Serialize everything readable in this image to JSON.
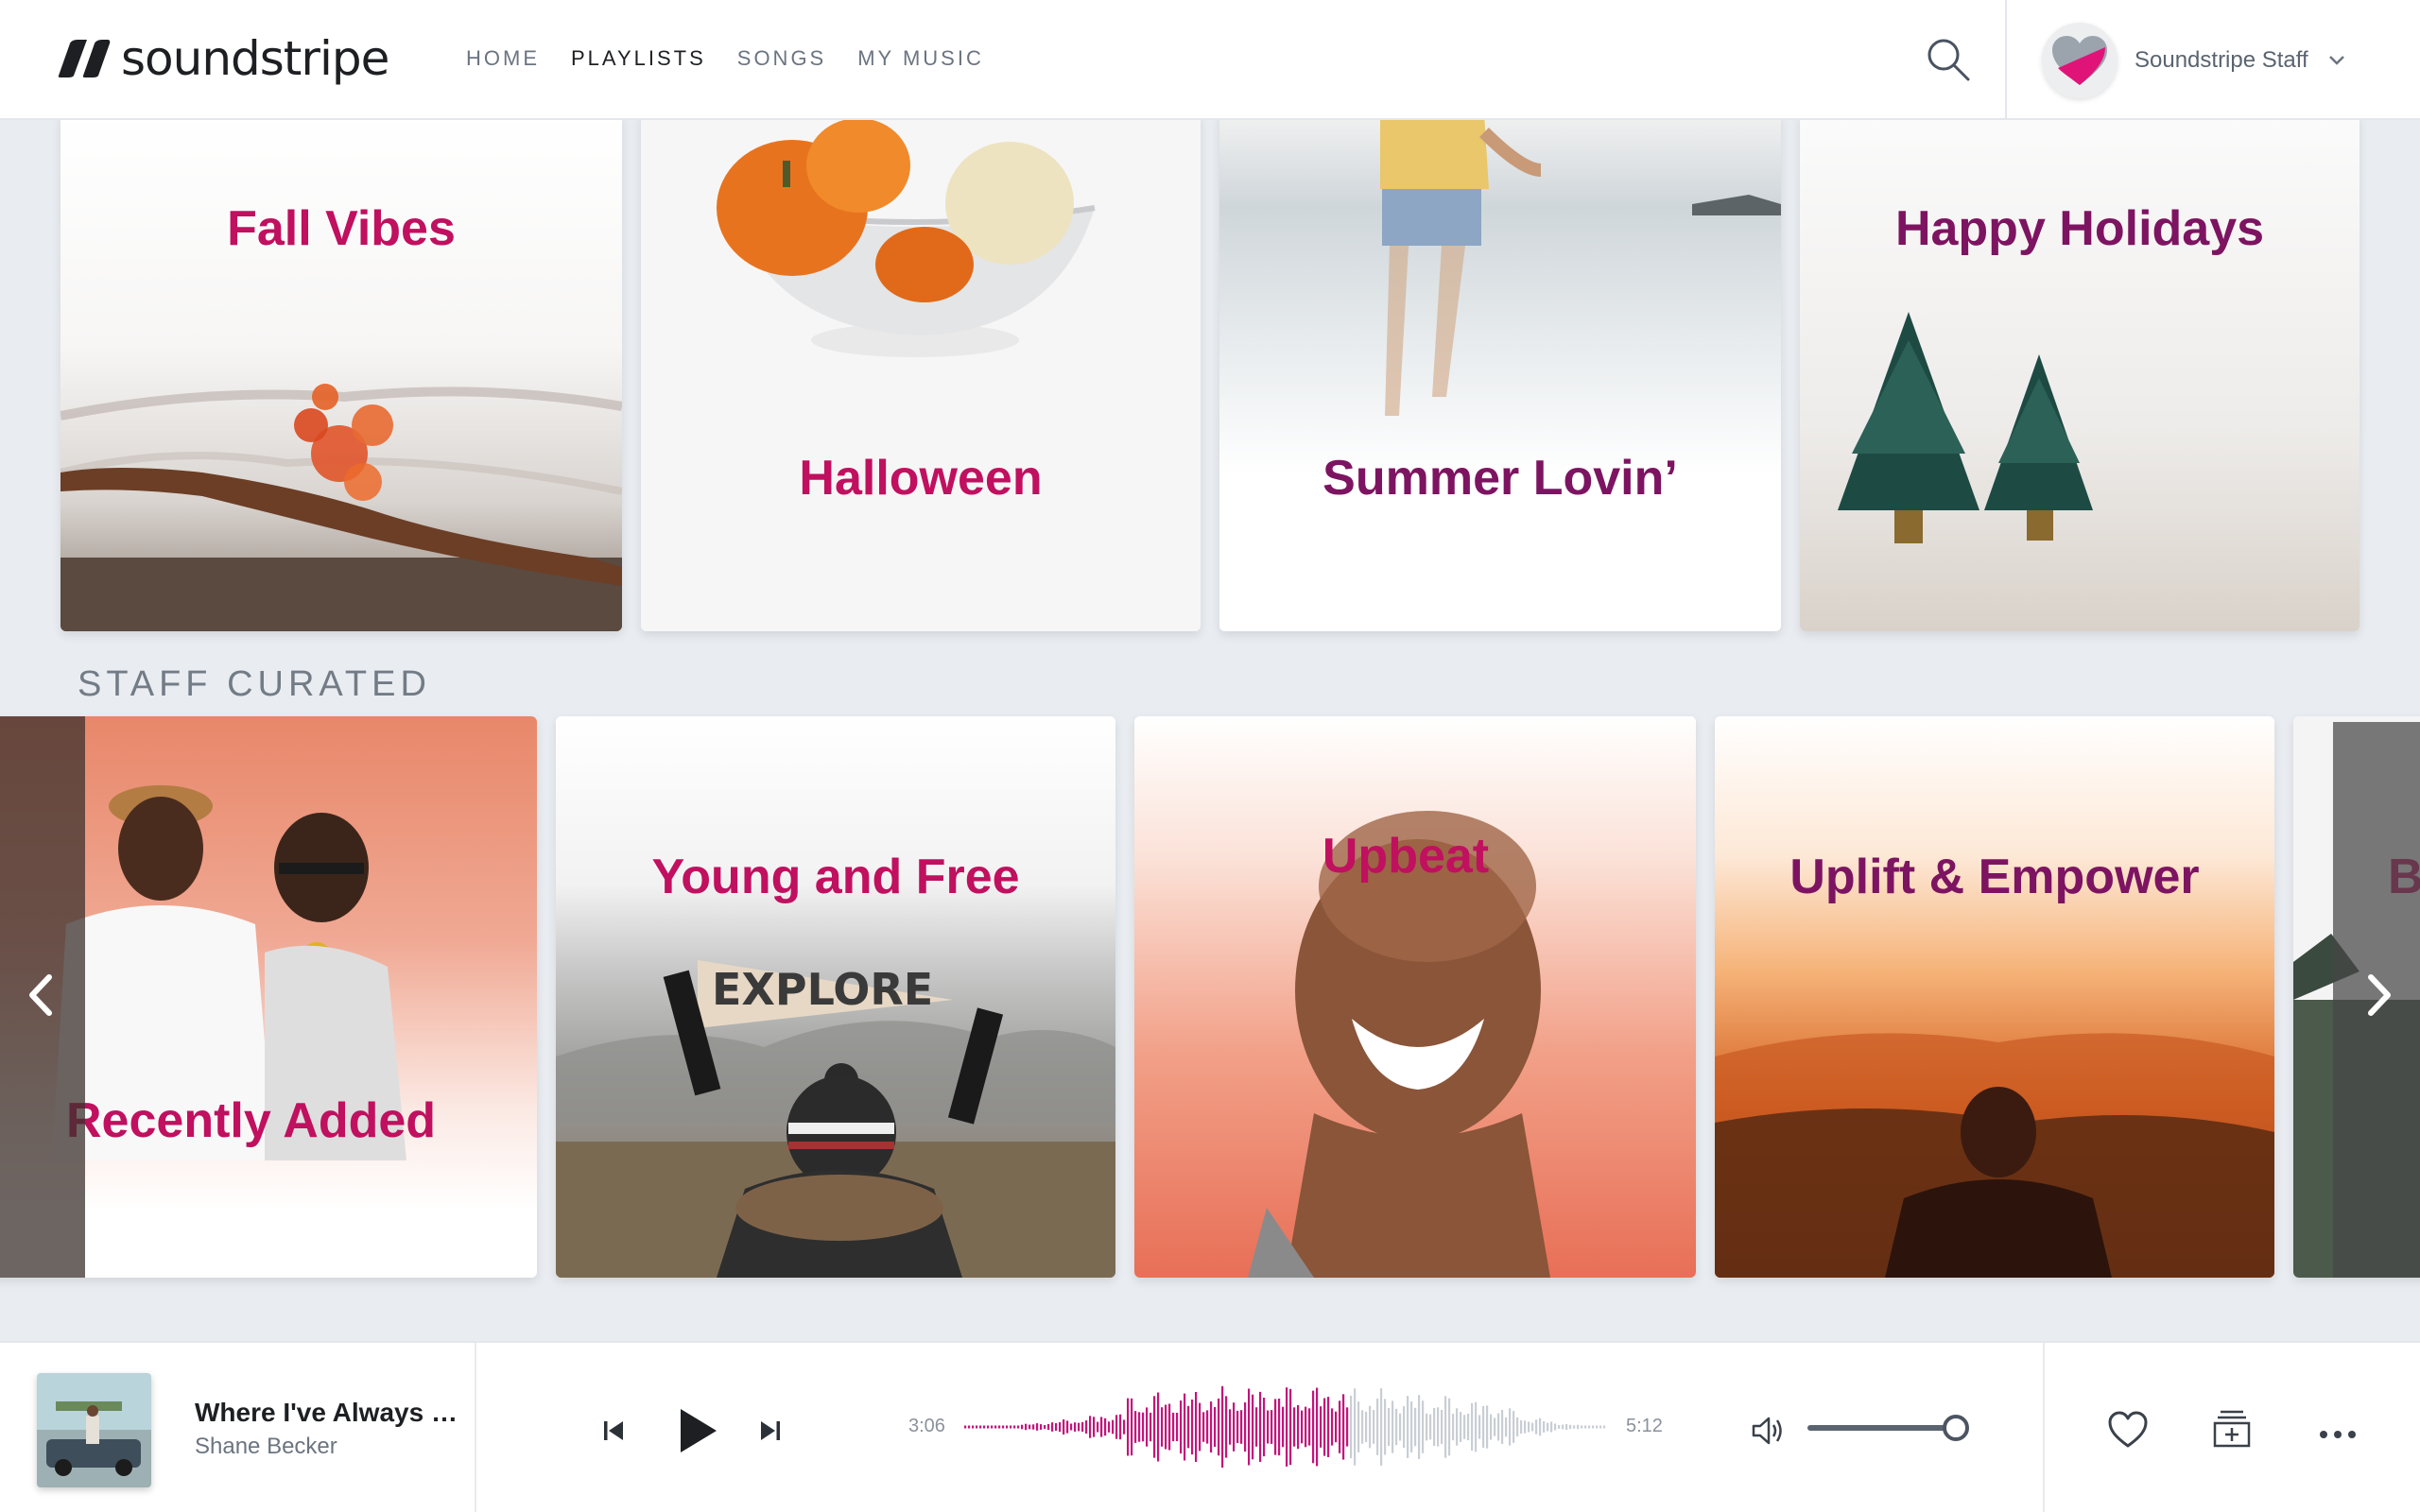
{
  "header": {
    "logo_text": "soundstripe",
    "nav": [
      {
        "label": "HOME",
        "active": false
      },
      {
        "label": "PLAYLISTS",
        "active": true
      },
      {
        "label": "SONGS",
        "active": false
      },
      {
        "label": "MY MUSIC",
        "active": false
      }
    ],
    "user_name": "Soundstripe Staff"
  },
  "playlists_row1": [
    {
      "title": "Fall Vibes"
    },
    {
      "title": "Halloween"
    },
    {
      "title": "Summer Lovin’"
    },
    {
      "title": "Happy Holidays"
    }
  ],
  "staff_curated": {
    "section_title": "STAFF CURATED",
    "items": [
      {
        "title": "Recently Added"
      },
      {
        "title": "Young and Free"
      },
      {
        "title": "Upbeat"
      },
      {
        "title": "Uplift & Empower"
      },
      {
        "title": "B"
      }
    ],
    "banner_text": "EXPLORE"
  },
  "player": {
    "track_title": "Where I've Always …",
    "artist": "Shane Becker",
    "elapsed": "3:06",
    "duration": "5:12",
    "progress": 0.6,
    "volume": 0.9
  },
  "colors": {
    "accent": "#c0105f",
    "accent_dark": "#7d1461",
    "waveform_played": "#c2157a",
    "waveform_unplayed": "#c9ced4"
  },
  "icons": [
    "search-icon",
    "chevron-down-icon",
    "chevron-left-icon",
    "chevron-right-icon",
    "previous-icon",
    "play-icon",
    "next-icon",
    "volume-icon",
    "heart-icon",
    "add-to-playlist-icon",
    "more-icon"
  ]
}
